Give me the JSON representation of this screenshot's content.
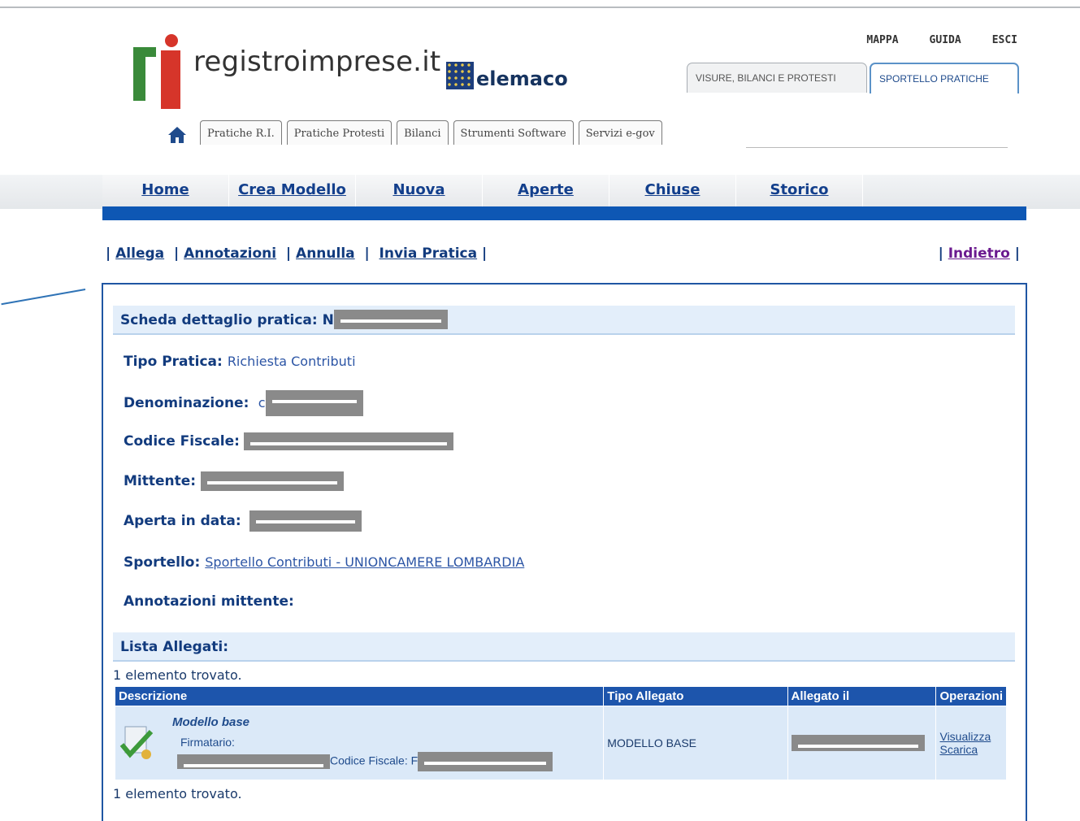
{
  "header": {
    "logo_text": "registroimprese.it",
    "partner_text": "elemaco",
    "top_links": [
      "MAPPA",
      "GUIDA",
      "ESCI"
    ],
    "service_tabs": [
      "VISURE, BILANCI E PROTESTI",
      "SPORTELLO PRATICHE"
    ],
    "home_icon": "home-icon",
    "section_tabs": [
      "Pratiche R.I.",
      "Pratiche Protesti",
      "Bilanci",
      "Strumenti Software",
      "Servizi e-gov"
    ]
  },
  "nav": {
    "items": [
      "Home",
      "Crea Modello",
      "Nuova",
      "Aperte",
      "Chiuse",
      "Storico"
    ]
  },
  "actions": {
    "items": [
      "Allega",
      "Annotazioni",
      "Annulla",
      "Invia Pratica"
    ],
    "back": "Indietro"
  },
  "detail": {
    "title": "Scheda dettaglio pratica:",
    "title_prefix": "N",
    "tipo_label": "Tipo Pratica:",
    "tipo_value": "Richiesta Contributi",
    "denominazione_label": "Denominazione:",
    "denominazione_prefix": "c",
    "codice_label": "Codice Fiscale:",
    "mittente_label": "Mittente:",
    "aperta_label": "Aperta in data:",
    "sportello_label": "Sportello:",
    "sportello_value": "Sportello Contributi - UNIONCAMERE LOMBARDIA",
    "annotazioni_label": "Annotazioni mittente:"
  },
  "attachments": {
    "title": "Lista Allegati:",
    "count_text": "1 elemento trovato.",
    "columns": [
      "Descrizione",
      "Tipo Allegato",
      "Allegato il",
      "Operazioni"
    ],
    "rows": [
      {
        "name": "Modello base",
        "signer_label": "Firmatario:",
        "cf_label": "Codice Fiscale:",
        "cf_prefix": "F",
        "type": "MODELLO BASE",
        "ops": [
          "Visualizza",
          "Scarica"
        ]
      }
    ]
  },
  "colors": {
    "accent": "#0e57b4",
    "header_blue": "#1d55ac",
    "panel_bg": "#e3eefa"
  }
}
